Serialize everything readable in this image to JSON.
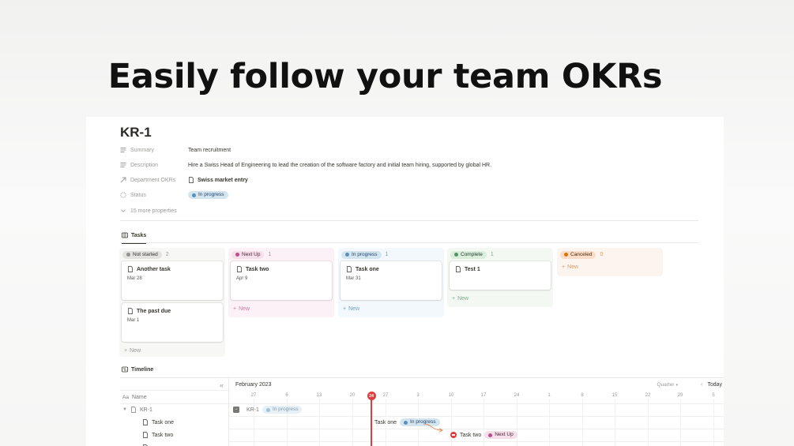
{
  "headline": "Easily follow your team OKRs",
  "page": {
    "title": "KR-1",
    "properties": [
      {
        "name": "Summary",
        "icon": "text-lines-icon",
        "value": "Team recruitment"
      },
      {
        "name": "Description",
        "icon": "text-lines-icon",
        "value": "Hire a Swiss Head of Engineering to lead the creation of the software factory and initial team hiring, supported by global HR."
      },
      {
        "name": "Department OKRs",
        "icon": "relation-arrow-icon",
        "value": "Swiss market entry"
      },
      {
        "name": "Status",
        "icon": "status-spinner-icon",
        "value": "In progress"
      }
    ],
    "more_properties": "15 more properties"
  },
  "board": {
    "tab": "Tasks",
    "new_label": "New",
    "columns": [
      {
        "status": "Not started",
        "count": "2",
        "color": "gray",
        "bg": "#f7f7f5",
        "cards": [
          {
            "title": "Another task",
            "date": "Mar 28"
          },
          {
            "title": "The past due",
            "date": "Mar 1"
          }
        ]
      },
      {
        "status": "Next Up",
        "count": "1",
        "color": "pink",
        "bg": "#fcf1f6",
        "cards": [
          {
            "title": "Task two",
            "date": "Apr 9"
          }
        ]
      },
      {
        "status": "In progress",
        "count": "1",
        "color": "blue",
        "bg": "#f2f8fb",
        "cards": [
          {
            "title": "Task one",
            "date": "Mar 31"
          }
        ]
      },
      {
        "status": "Complete",
        "count": "1",
        "color": "green",
        "bg": "#f4f8f3",
        "cards": [
          {
            "title": "Test 1",
            "date": ""
          }
        ]
      },
      {
        "status": "Canceled",
        "count": "0",
        "color": "orange",
        "bg": "#fcf4ee",
        "cards": []
      }
    ]
  },
  "timeline": {
    "tab": "Timeline",
    "month": "February 2023",
    "name_header": "Name",
    "name_header_prefix": "Aa",
    "collapse_glyph": "«",
    "range_label": "Quarter",
    "today_label": "Today",
    "today_marker": "24",
    "ticks": [
      "27",
      "6",
      "13",
      "20",
      "24",
      "27",
      "3",
      "10",
      "17",
      "24",
      "1",
      "8",
      "15",
      "22",
      "29",
      "5"
    ],
    "rows": [
      {
        "name": "KR-1",
        "level": 0,
        "status": "In progress"
      },
      {
        "name": "Task one",
        "level": 1,
        "status": "In progress"
      },
      {
        "name": "Task two",
        "level": 1,
        "status": "Next Up"
      }
    ],
    "colors": {
      "today": "#e03e3e",
      "accent_blue": "#5a8fbd",
      "accent_pink": "#c14c8a"
    }
  }
}
